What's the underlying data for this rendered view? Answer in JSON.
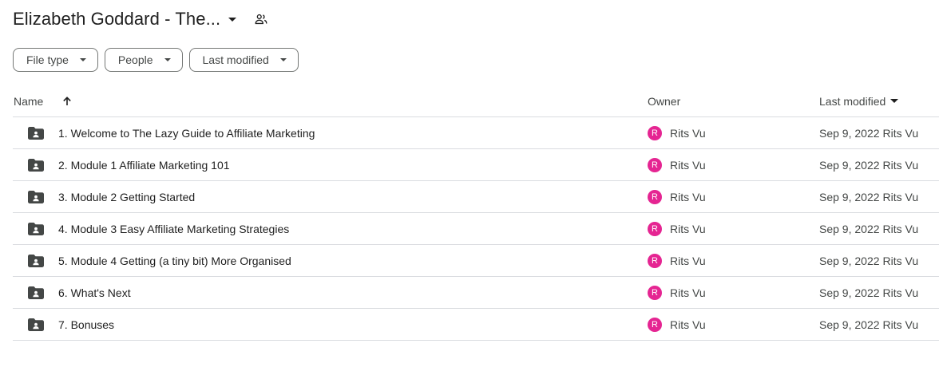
{
  "title": {
    "text": "Elizabeth Goddard - The...",
    "share_icon": "people-outline-icon"
  },
  "filters": [
    {
      "label": "File type"
    },
    {
      "label": "People"
    },
    {
      "label": "Last modified"
    }
  ],
  "columns": {
    "name": "Name",
    "owner": "Owner",
    "last_modified": "Last modified"
  },
  "rows": [
    {
      "name": "1. Welcome to The Lazy Guide to Affiliate Marketing",
      "owner": "Rits Vu",
      "avatar": "R",
      "date": "Sep 9, 2022",
      "by": "Rits Vu"
    },
    {
      "name": "2. Module 1 Affiliate Marketing 101",
      "owner": "Rits Vu",
      "avatar": "R",
      "date": "Sep 9, 2022",
      "by": "Rits Vu"
    },
    {
      "name": "3. Module 2 Getting Started",
      "owner": "Rits Vu",
      "avatar": "R",
      "date": "Sep 9, 2022",
      "by": "Rits Vu"
    },
    {
      "name": "4. Module 3 Easy Affiliate Marketing Strategies",
      "owner": "Rits Vu",
      "avatar": "R",
      "date": "Sep 9, 2022",
      "by": "Rits Vu"
    },
    {
      "name": "5. Module 4 Getting (a tiny bit) More Organised",
      "owner": "Rits Vu",
      "avatar": "R",
      "date": "Sep 9, 2022",
      "by": "Rits Vu"
    },
    {
      "name": "6. What's Next",
      "owner": "Rits Vu",
      "avatar": "R",
      "date": "Sep 9, 2022",
      "by": "Rits Vu"
    },
    {
      "name": "7. Bonuses",
      "owner": "Rits Vu",
      "avatar": "R",
      "date": "Sep 9, 2022",
      "by": "Rits Vu"
    }
  ],
  "colors": {
    "avatar": "#e52592",
    "divider": "#dadce0",
    "folder_icon": "#444746"
  }
}
